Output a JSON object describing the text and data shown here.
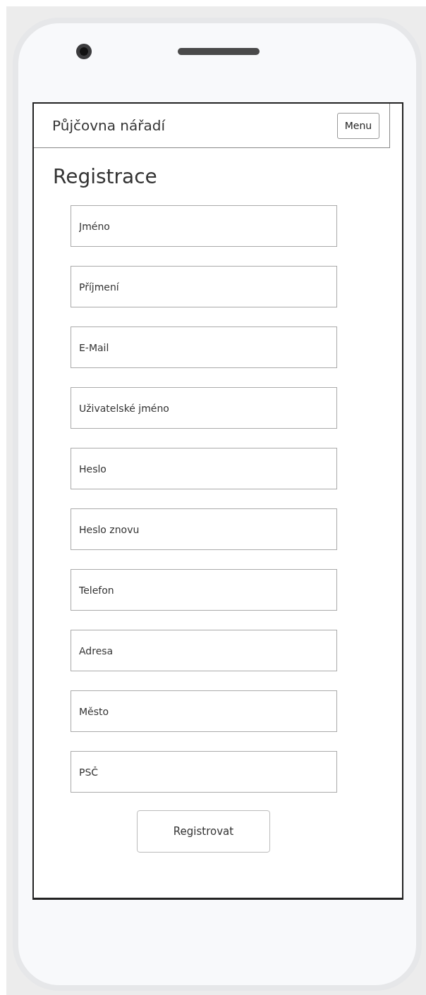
{
  "header": {
    "title": "Půjčovna nářadí",
    "menu_button": "Menu"
  },
  "page_title": "Registrace",
  "fields": [
    {
      "placeholder": "Jméno"
    },
    {
      "placeholder": "Příjmení"
    },
    {
      "placeholder": "E-Mail"
    },
    {
      "placeholder": "Uživatelské jméno"
    },
    {
      "placeholder": "Heslo"
    },
    {
      "placeholder": "Heslo znovu"
    },
    {
      "placeholder": "Telefon"
    },
    {
      "placeholder": "Adresa"
    },
    {
      "placeholder": "Město"
    },
    {
      "placeholder": "PSČ"
    }
  ],
  "submit_button": "Registrovat"
}
